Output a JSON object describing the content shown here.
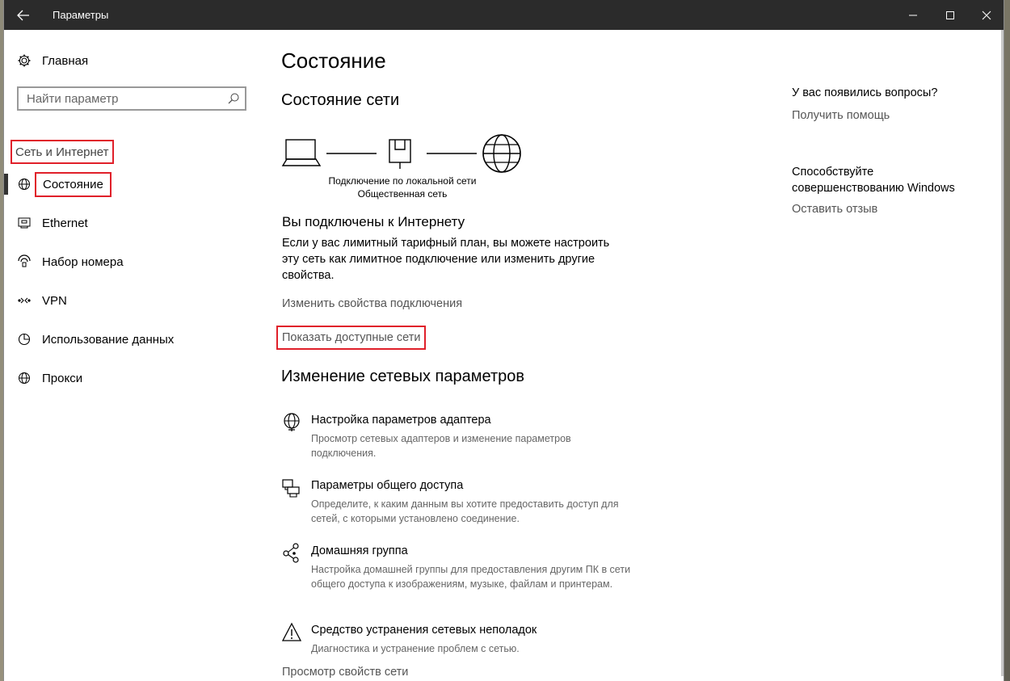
{
  "window": {
    "title": "Параметры",
    "back_icon": "back-arrow-icon",
    "minimize_icon": "minimize-icon",
    "maximize_icon": "maximize-icon",
    "close_icon": "close-icon"
  },
  "sidebar": {
    "home_label": "Главная",
    "search_placeholder": "Найти параметр",
    "section_title": "Сеть и Интернет",
    "items": [
      {
        "label": "Состояние",
        "icon": "globe-icon",
        "selected": true
      },
      {
        "label": "Ethernet",
        "icon": "ethernet-icon"
      },
      {
        "label": "Набор номера",
        "icon": "dialup-icon"
      },
      {
        "label": "VPN",
        "icon": "vpn-icon"
      },
      {
        "label": "Использование данных",
        "icon": "data-usage-icon"
      },
      {
        "label": "Прокси",
        "icon": "globe-icon"
      }
    ]
  },
  "main": {
    "title": "Состояние",
    "network_status_title": "Состояние сети",
    "network_name": "Подключение по локальной сети",
    "network_type": "Общественная сеть",
    "connected_title": "Вы подключены к Интернету",
    "connected_desc": "Если у вас лимитный тарифный план, вы можете настроить эту сеть как лимитное подключение или изменить другие свойства.",
    "change_props_link": "Изменить свойства подключения",
    "show_networks_link": "Показать доступные сети",
    "change_settings_title": "Изменение сетевых параметров",
    "options": [
      {
        "title": "Настройка параметров адаптера",
        "desc": "Просмотр сетевых адаптеров и изменение параметров подключения.",
        "icon": "adapter-icon"
      },
      {
        "title": "Параметры общего доступа",
        "desc": "Определите, к каким данным вы хотите предоставить доступ для сетей, с которыми установлено соединение.",
        "icon": "sharing-icon"
      },
      {
        "title": "Домашняя группа",
        "desc": "Настройка домашней группы для предоставления другим ПК в сети общего доступа к изображениям, музыке, файлам и принтерам.",
        "icon": "homegroup-icon"
      },
      {
        "title": "Средство устранения сетевых неполадок",
        "desc": "Диагностика и устранение проблем с сетью.",
        "icon": "warning-icon"
      }
    ],
    "view_props_link": "Просмотр свойств сети"
  },
  "aside": {
    "questions_title": "У вас появились вопросы?",
    "help_link": "Получить помощь",
    "improve_title": "Способствуйте совершенствованию Windows",
    "feedback_link": "Оставить отзыв"
  },
  "colors": {
    "titlebar": "#2b2b2b",
    "highlight_box": "#e0202a",
    "link": "#555555"
  }
}
